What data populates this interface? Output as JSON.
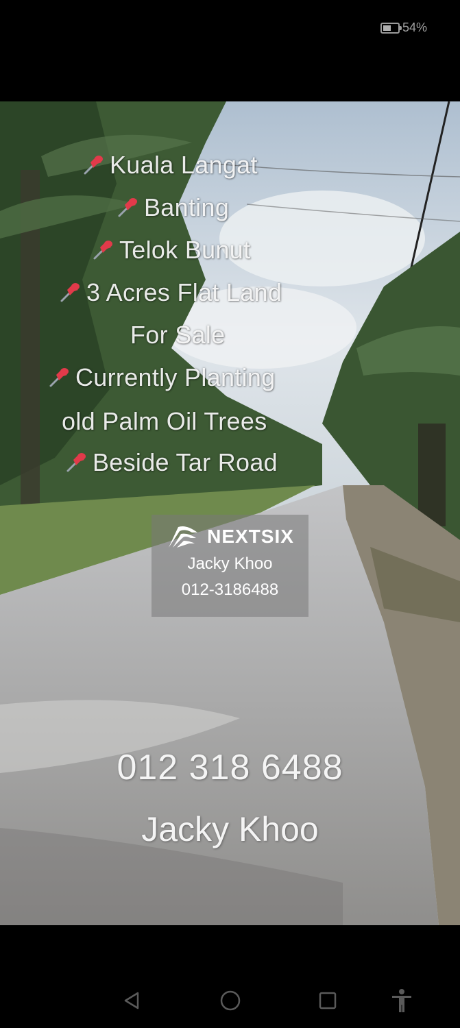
{
  "status_bar": {
    "battery_level": 0.54,
    "battery_text": "54%"
  },
  "video": {
    "overlay_lines": [
      {
        "text": "Kuala Langat",
        "pin": true
      },
      {
        "text": "Banting",
        "pin": true
      },
      {
        "text": "Telok Bunut",
        "pin": true
      },
      {
        "text": "3 Acres Flat Land",
        "pin": true
      },
      {
        "text": "For Sale",
        "pin": false
      },
      {
        "text": "Currently Planting",
        "pin": true
      },
      {
        "text": "old Palm Oil Trees",
        "pin": false
      },
      {
        "text": "Beside Tar Road",
        "pin": true
      }
    ],
    "watermark": {
      "brand": "NEXTSIX",
      "agent_name": "Jacky Khoo",
      "agent_phone": "012-3186488"
    },
    "big_phone": "012 318 6488",
    "big_name": "Jacky Khoo"
  },
  "nav_bar": {
    "buttons": [
      "back-icon",
      "home-icon",
      "recents-icon",
      "accessibility-icon"
    ]
  },
  "colors": {
    "pin": "#e23a4a",
    "sky": "#c9d3dd",
    "road": "#a9a8a6",
    "foliage": "#2f4a2a"
  }
}
